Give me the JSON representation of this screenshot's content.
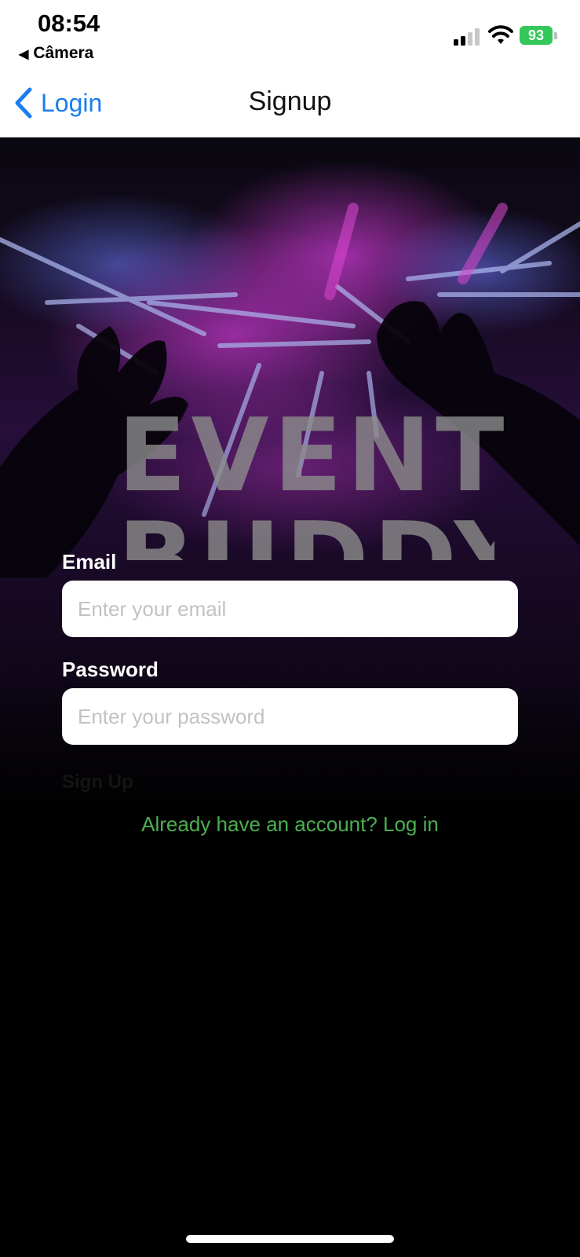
{
  "status_bar": {
    "time": "08:54",
    "back_app": "Câmera",
    "battery": "93"
  },
  "nav": {
    "back_label": "Login",
    "title": "Signup"
  },
  "hero": {
    "logo_line1": "EVENT",
    "logo_line2": "BUDDY"
  },
  "form": {
    "email_label": "Email",
    "email_placeholder": "Enter your email",
    "email_value": "",
    "password_label": "Password",
    "password_placeholder": "Enter your password",
    "password_value": "",
    "signup_label": "Sign Up",
    "login_link": "Already have an account? Log in"
  },
  "colors": {
    "accent_blue": "#1a7df0",
    "link_green": "#4caf50",
    "battery_green": "#34c759"
  }
}
